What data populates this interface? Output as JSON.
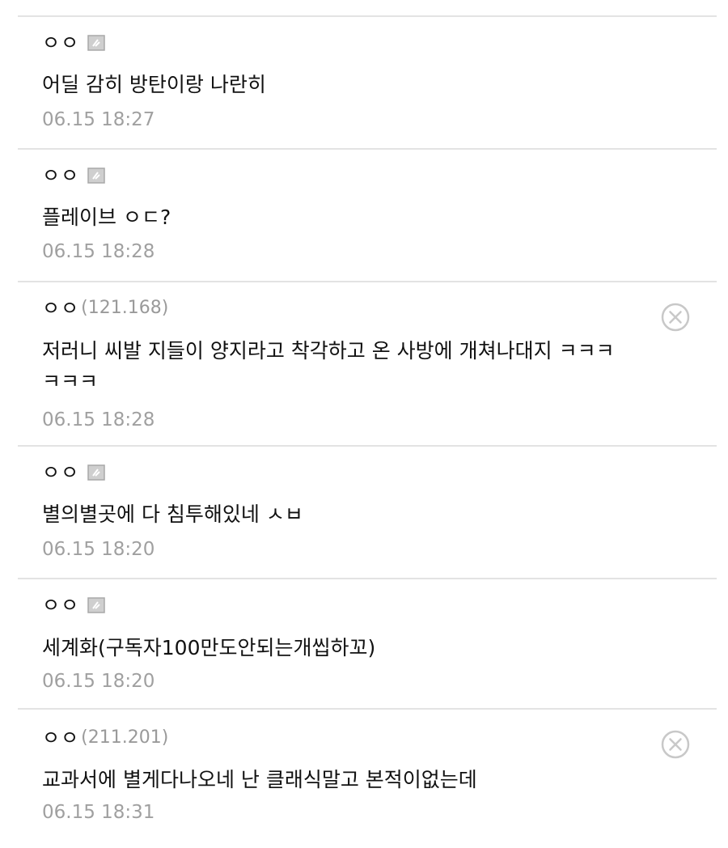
{
  "comments": [
    {
      "nick": "ㅇㅇ",
      "ip": "",
      "member_icon": "member-badge-icon",
      "text": "어딜 감히 방탄이랑 나란히",
      "date": "06.15 18:27"
    },
    {
      "nick": "ㅇㅇ",
      "ip": "",
      "member_icon": "member-badge-icon",
      "text": "플레이브 ㅇㄷ?",
      "date": "06.15 18:28"
    },
    {
      "nick": "ㅇㅇ",
      "ip": "(121.168)",
      "delete_icon": "close-circle-icon",
      "text": "저러니 씨발 지들이 양지라고 착각하고 온 사방에 개쳐나대지 ㅋㅋㅋ\nㅋㅋㅋ",
      "date": "06.15 18:28"
    },
    {
      "nick": "ㅇㅇ",
      "ip": "",
      "member_icon": "member-badge-icon",
      "text": "별의별곳에 다 침투해있네 ㅅㅂ",
      "date": "06.15 18:20"
    },
    {
      "nick": "ㅇㅇ",
      "ip": "",
      "member_icon": "member-badge-icon",
      "text": "세계화(구독자100만도안되는개씹하꼬)",
      "date": "06.15 18:20"
    },
    {
      "nick": "ㅇㅇ",
      "ip": "(211.201)",
      "delete_icon": "close-circle-icon",
      "text": "교과서에 별게다나오네 난 클래식말고 본적이없는데",
      "date": "06.15 18:31"
    }
  ],
  "colors": {
    "text": "#111111",
    "meta": "#a0a0a0",
    "divider": "#e3e3e3",
    "icon": "#c8c8c8"
  }
}
